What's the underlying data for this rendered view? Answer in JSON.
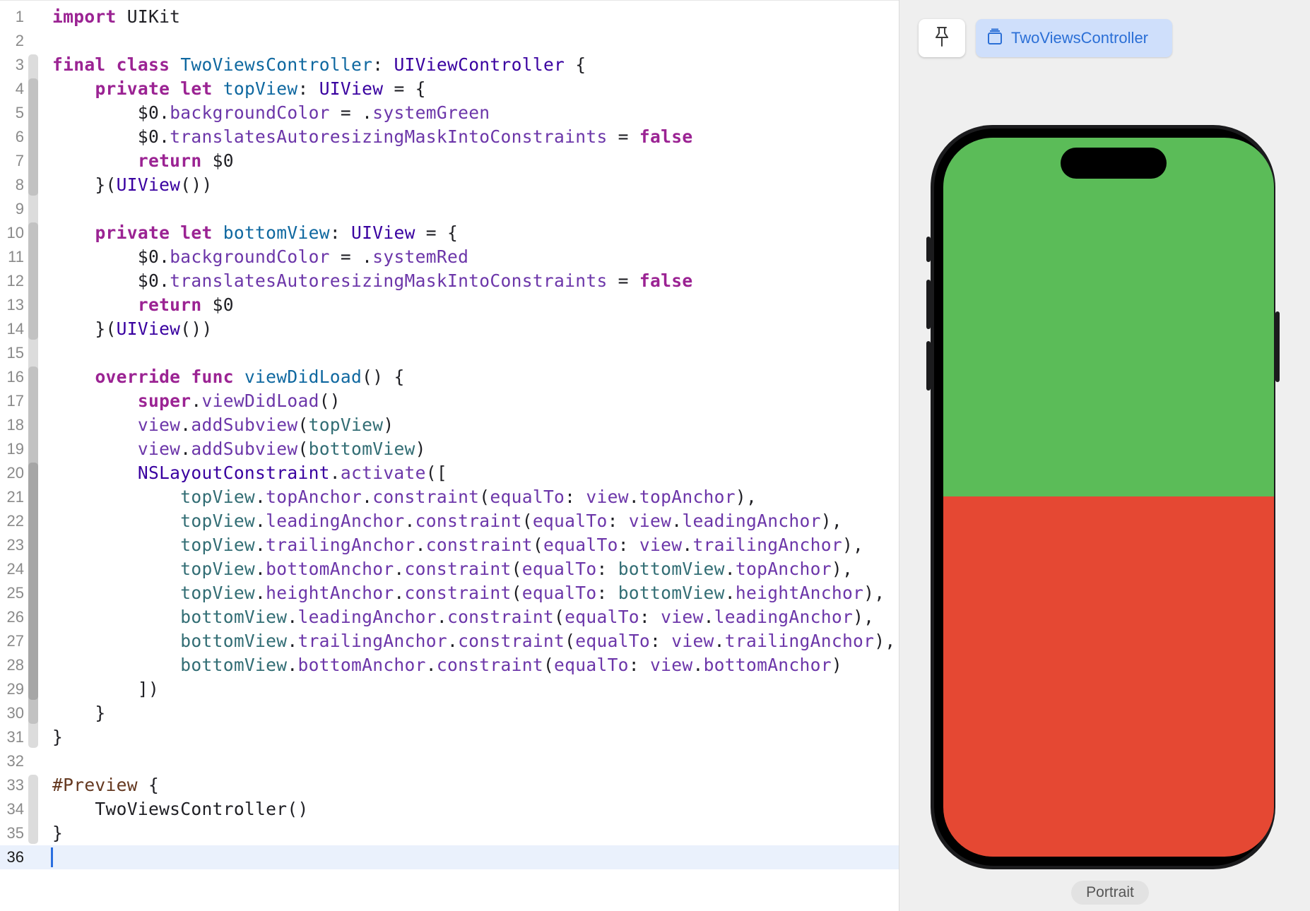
{
  "editor": {
    "current_line": 36,
    "lines": [
      {
        "n": "1",
        "tokens": [
          [
            "kw",
            "import"
          ],
          [
            "plain",
            " UIKit"
          ]
        ]
      },
      {
        "n": "2",
        "tokens": []
      },
      {
        "n": "3",
        "tokens": [
          [
            "kw",
            "final"
          ],
          [
            "plain",
            " "
          ],
          [
            "kw",
            "class"
          ],
          [
            "plain",
            " "
          ],
          [
            "decl",
            "TwoViewsController"
          ],
          [
            "plain",
            ": "
          ],
          [
            "ty",
            "UIViewController"
          ],
          [
            "plain",
            " {"
          ]
        ]
      },
      {
        "n": "4",
        "tokens": [
          [
            "plain",
            "    "
          ],
          [
            "kw",
            "private"
          ],
          [
            "plain",
            " "
          ],
          [
            "kw",
            "let"
          ],
          [
            "plain",
            " "
          ],
          [
            "decl",
            "topView"
          ],
          [
            "plain",
            ": "
          ],
          [
            "ty",
            "UIView"
          ],
          [
            "plain",
            " = {"
          ]
        ]
      },
      {
        "n": "5",
        "tokens": [
          [
            "plain",
            "        $0."
          ],
          [
            "mem",
            "backgroundColor"
          ],
          [
            "plain",
            " = ."
          ],
          [
            "mem",
            "systemGreen"
          ]
        ]
      },
      {
        "n": "6",
        "tokens": [
          [
            "plain",
            "        $0."
          ],
          [
            "mem",
            "translatesAutoresizingMaskIntoConstraints"
          ],
          [
            "plain",
            " = "
          ],
          [
            "kw",
            "false"
          ]
        ]
      },
      {
        "n": "7",
        "tokens": [
          [
            "plain",
            "        "
          ],
          [
            "kw",
            "return"
          ],
          [
            "plain",
            " $0"
          ]
        ]
      },
      {
        "n": "8",
        "tokens": [
          [
            "plain",
            "    }("
          ],
          [
            "ty",
            "UIView"
          ],
          [
            "plain",
            "())"
          ]
        ]
      },
      {
        "n": "9",
        "tokens": []
      },
      {
        "n": "10",
        "tokens": [
          [
            "plain",
            "    "
          ],
          [
            "kw",
            "private"
          ],
          [
            "plain",
            " "
          ],
          [
            "kw",
            "let"
          ],
          [
            "plain",
            " "
          ],
          [
            "decl",
            "bottomView"
          ],
          [
            "plain",
            ": "
          ],
          [
            "ty",
            "UIView"
          ],
          [
            "plain",
            " = {"
          ]
        ]
      },
      {
        "n": "11",
        "tokens": [
          [
            "plain",
            "        $0."
          ],
          [
            "mem",
            "backgroundColor"
          ],
          [
            "plain",
            " = ."
          ],
          [
            "mem",
            "systemRed"
          ]
        ]
      },
      {
        "n": "12",
        "tokens": [
          [
            "plain",
            "        $0."
          ],
          [
            "mem",
            "translatesAutoresizingMaskIntoConstraints"
          ],
          [
            "plain",
            " = "
          ],
          [
            "kw",
            "false"
          ]
        ]
      },
      {
        "n": "13",
        "tokens": [
          [
            "plain",
            "        "
          ],
          [
            "kw",
            "return"
          ],
          [
            "plain",
            " $0"
          ]
        ]
      },
      {
        "n": "14",
        "tokens": [
          [
            "plain",
            "    }("
          ],
          [
            "ty",
            "UIView"
          ],
          [
            "plain",
            "())"
          ]
        ]
      },
      {
        "n": "15",
        "tokens": []
      },
      {
        "n": "16",
        "tokens": [
          [
            "plain",
            "    "
          ],
          [
            "kw",
            "override"
          ],
          [
            "plain",
            " "
          ],
          [
            "kw",
            "func"
          ],
          [
            "plain",
            " "
          ],
          [
            "decl",
            "viewDidLoad"
          ],
          [
            "plain",
            "() {"
          ]
        ]
      },
      {
        "n": "17",
        "tokens": [
          [
            "plain",
            "        "
          ],
          [
            "kw",
            "super"
          ],
          [
            "plain",
            "."
          ],
          [
            "mem",
            "viewDidLoad"
          ],
          [
            "plain",
            "()"
          ]
        ]
      },
      {
        "n": "18",
        "tokens": [
          [
            "plain",
            "        "
          ],
          [
            "mem",
            "view"
          ],
          [
            "plain",
            "."
          ],
          [
            "mem",
            "addSubview"
          ],
          [
            "plain",
            "("
          ],
          [
            "ref",
            "topView"
          ],
          [
            "plain",
            ")"
          ]
        ]
      },
      {
        "n": "19",
        "tokens": [
          [
            "plain",
            "        "
          ],
          [
            "mem",
            "view"
          ],
          [
            "plain",
            "."
          ],
          [
            "mem",
            "addSubview"
          ],
          [
            "plain",
            "("
          ],
          [
            "ref",
            "bottomView"
          ],
          [
            "plain",
            ")"
          ]
        ]
      },
      {
        "n": "20",
        "tokens": [
          [
            "plain",
            "        "
          ],
          [
            "ty",
            "NSLayoutConstraint"
          ],
          [
            "plain",
            "."
          ],
          [
            "mem",
            "activate"
          ],
          [
            "plain",
            "(["
          ]
        ]
      },
      {
        "n": "21",
        "tokens": [
          [
            "plain",
            "            "
          ],
          [
            "ref",
            "topView"
          ],
          [
            "plain",
            "."
          ],
          [
            "mem",
            "topAnchor"
          ],
          [
            "plain",
            "."
          ],
          [
            "mem",
            "constraint"
          ],
          [
            "plain",
            "("
          ],
          [
            "mem",
            "equalTo"
          ],
          [
            "plain",
            ": "
          ],
          [
            "mem",
            "view"
          ],
          [
            "plain",
            "."
          ],
          [
            "mem",
            "topAnchor"
          ],
          [
            "plain",
            "),"
          ]
        ]
      },
      {
        "n": "22",
        "tokens": [
          [
            "plain",
            "            "
          ],
          [
            "ref",
            "topView"
          ],
          [
            "plain",
            "."
          ],
          [
            "mem",
            "leadingAnchor"
          ],
          [
            "plain",
            "."
          ],
          [
            "mem",
            "constraint"
          ],
          [
            "plain",
            "("
          ],
          [
            "mem",
            "equalTo"
          ],
          [
            "plain",
            ": "
          ],
          [
            "mem",
            "view"
          ],
          [
            "plain",
            "."
          ],
          [
            "mem",
            "leadingAnchor"
          ],
          [
            "plain",
            "),"
          ]
        ]
      },
      {
        "n": "23",
        "tokens": [
          [
            "plain",
            "            "
          ],
          [
            "ref",
            "topView"
          ],
          [
            "plain",
            "."
          ],
          [
            "mem",
            "trailingAnchor"
          ],
          [
            "plain",
            "."
          ],
          [
            "mem",
            "constraint"
          ],
          [
            "plain",
            "("
          ],
          [
            "mem",
            "equalTo"
          ],
          [
            "plain",
            ": "
          ],
          [
            "mem",
            "view"
          ],
          [
            "plain",
            "."
          ],
          [
            "mem",
            "trailingAnchor"
          ],
          [
            "plain",
            "),"
          ]
        ]
      },
      {
        "n": "24",
        "tokens": [
          [
            "plain",
            "            "
          ],
          [
            "ref",
            "topView"
          ],
          [
            "plain",
            "."
          ],
          [
            "mem",
            "bottomAnchor"
          ],
          [
            "plain",
            "."
          ],
          [
            "mem",
            "constraint"
          ],
          [
            "plain",
            "("
          ],
          [
            "mem",
            "equalTo"
          ],
          [
            "plain",
            ": "
          ],
          [
            "ref",
            "bottomView"
          ],
          [
            "plain",
            "."
          ],
          [
            "mem",
            "topAnchor"
          ],
          [
            "plain",
            "),"
          ]
        ]
      },
      {
        "n": "25",
        "tokens": [
          [
            "plain",
            "            "
          ],
          [
            "ref",
            "topView"
          ],
          [
            "plain",
            "."
          ],
          [
            "mem",
            "heightAnchor"
          ],
          [
            "plain",
            "."
          ],
          [
            "mem",
            "constraint"
          ],
          [
            "plain",
            "("
          ],
          [
            "mem",
            "equalTo"
          ],
          [
            "plain",
            ": "
          ],
          [
            "ref",
            "bottomView"
          ],
          [
            "plain",
            "."
          ],
          [
            "mem",
            "heightAnchor"
          ],
          [
            "plain",
            "),"
          ]
        ]
      },
      {
        "n": "26",
        "tokens": [
          [
            "plain",
            "            "
          ],
          [
            "ref",
            "bottomView"
          ],
          [
            "plain",
            "."
          ],
          [
            "mem",
            "leadingAnchor"
          ],
          [
            "plain",
            "."
          ],
          [
            "mem",
            "constraint"
          ],
          [
            "plain",
            "("
          ],
          [
            "mem",
            "equalTo"
          ],
          [
            "plain",
            ": "
          ],
          [
            "mem",
            "view"
          ],
          [
            "plain",
            "."
          ],
          [
            "mem",
            "leadingAnchor"
          ],
          [
            "plain",
            "),"
          ]
        ]
      },
      {
        "n": "27",
        "tokens": [
          [
            "plain",
            "            "
          ],
          [
            "ref",
            "bottomView"
          ],
          [
            "plain",
            "."
          ],
          [
            "mem",
            "trailingAnchor"
          ],
          [
            "plain",
            "."
          ],
          [
            "mem",
            "constraint"
          ],
          [
            "plain",
            "("
          ],
          [
            "mem",
            "equalTo"
          ],
          [
            "plain",
            ": "
          ],
          [
            "mem",
            "view"
          ],
          [
            "plain",
            "."
          ],
          [
            "mem",
            "trailingAnchor"
          ],
          [
            "plain",
            "),"
          ]
        ]
      },
      {
        "n": "28",
        "tokens": [
          [
            "plain",
            "            "
          ],
          [
            "ref",
            "bottomView"
          ],
          [
            "plain",
            "."
          ],
          [
            "mem",
            "bottomAnchor"
          ],
          [
            "plain",
            "."
          ],
          [
            "mem",
            "constraint"
          ],
          [
            "plain",
            "("
          ],
          [
            "mem",
            "equalTo"
          ],
          [
            "plain",
            ": "
          ],
          [
            "mem",
            "view"
          ],
          [
            "plain",
            "."
          ],
          [
            "mem",
            "bottomAnchor"
          ],
          [
            "plain",
            ")"
          ]
        ]
      },
      {
        "n": "29",
        "tokens": [
          [
            "plain",
            "        ])"
          ]
        ]
      },
      {
        "n": "30",
        "tokens": [
          [
            "plain",
            "    }"
          ]
        ]
      },
      {
        "n": "31",
        "tokens": [
          [
            "plain",
            "}"
          ]
        ]
      },
      {
        "n": "32",
        "tokens": []
      },
      {
        "n": "33",
        "tokens": [
          [
            "dir",
            "#Preview"
          ],
          [
            "plain",
            " {"
          ]
        ]
      },
      {
        "n": "34",
        "tokens": [
          [
            "plain",
            "    TwoViewsController()"
          ]
        ]
      },
      {
        "n": "35",
        "tokens": [
          [
            "plain",
            "}"
          ]
        ]
      },
      {
        "n": "36",
        "tokens": []
      }
    ]
  },
  "canvas": {
    "pin_icon": "pin-icon",
    "preview_icon": "view-controller-icon",
    "preview_title": "TwoViewsController",
    "top_view_color": "#5bbc58",
    "bottom_view_color": "#e54833",
    "orientation_label": "Portrait"
  }
}
